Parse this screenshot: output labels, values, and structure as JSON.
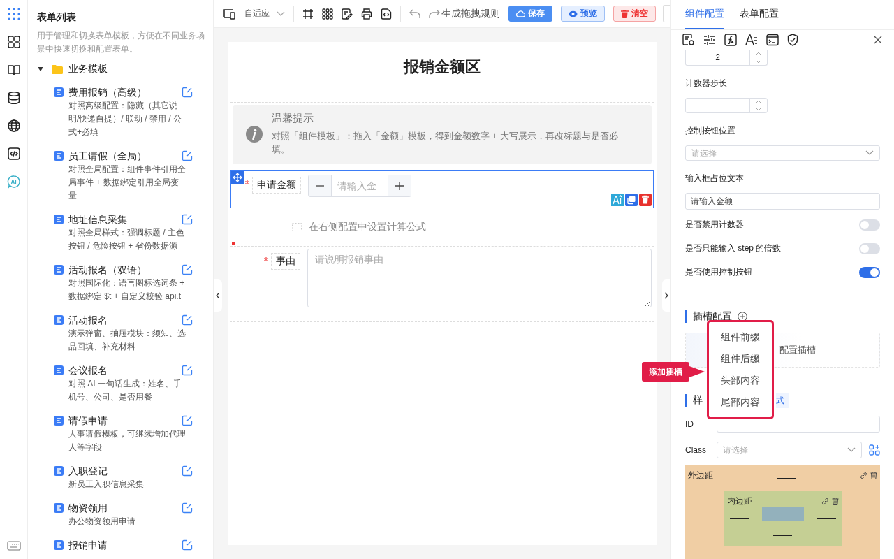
{
  "sidebar": {
    "title": "表单列表",
    "description": "用于管理和切换表单模板，方便在不同业务场景中快速切换和配置表单。",
    "folder": {
      "label": "业务模板",
      "expanded": true,
      "children": [
        {
          "title": "费用报销（高级）",
          "desc": "对照高级配置：隐藏（其它说明/快递自提）/ 联动 / 禁用 / 公式+必填"
        },
        {
          "title": "员工请假（全局）",
          "desc": "对照全局配置：组件事件引用全局事件 + 数据绑定引用全局变量"
        },
        {
          "title": "地址信息采集",
          "desc": "对照全局样式：强调标题 / 主色按钮 / 危险按钮 + 省份数据源"
        },
        {
          "title": "活动报名（双语）",
          "desc": "对照国际化：语言图标选词条 + 数据绑定 $t + 自定义校验 api.t"
        },
        {
          "title": "活动报名",
          "desc": "演示弹窗、抽屉模块：须知、选品回填、补充材料"
        },
        {
          "title": "会议报名",
          "desc": "对照 AI 一句话生成：姓名、手机号、公司、是否用餐"
        },
        {
          "title": "请假申请",
          "desc": "人事请假模板，可继续增加代理人等字段"
        },
        {
          "title": "入职登记",
          "desc": "新员工入职信息采集"
        },
        {
          "title": "物资领用",
          "desc": "办公物资领用申请"
        },
        {
          "title": "报销申请"
        }
      ]
    }
  },
  "toolbar": {
    "device": "自适应",
    "generate": "生成拖拽规则",
    "buttons": [
      {
        "label": "保存",
        "kind": "primary"
      },
      {
        "label": "预览",
        "kind": "info"
      },
      {
        "label": "清空",
        "kind": "danger"
      }
    ]
  },
  "canvas": {
    "heading": "报销金额区",
    "alert": {
      "title": "温馨提示",
      "text": "对照「组件模板」：拖入「金额」模板，得到金额数字 + 大写展示，再改标题与是否必填。"
    },
    "amount": {
      "label": "申请金额",
      "required": true,
      "placeholder": "请输入金",
      "selected": true
    },
    "formula_hint": "在右侧配置中设置计算公式",
    "reason": {
      "label": "事由",
      "required": true,
      "placeholder": "请说明报销事由"
    }
  },
  "panel": {
    "tabs": [
      {
        "label": "组件配置",
        "selected": true
      },
      {
        "label": "表单配置",
        "selected": false
      }
    ],
    "props": [
      {
        "kind": "number",
        "value": "2"
      },
      {
        "kind": "label",
        "text": "计数器步长"
      },
      {
        "kind": "number"
      },
      {
        "kind": "label",
        "text": "控制按钮位置"
      },
      {
        "kind": "select",
        "placeholder": "请选择"
      },
      {
        "kind": "label",
        "text": "输入框占位文本"
      },
      {
        "kind": "input",
        "value": "请输入金额"
      },
      {
        "kind": "switch",
        "text": "是否禁用计数器",
        "on": false
      },
      {
        "kind": "switch",
        "text": "是否只能输入 step 的倍数",
        "on": false
      },
      {
        "kind": "switch",
        "text": "是否使用控制按钮",
        "on": true
      }
    ],
    "slot_title": "插槽配置",
    "slot_hint": "配置插槽",
    "style_title": "样",
    "style_tag": "式",
    "id_label": "ID",
    "class_label": "Class",
    "class_placeholder": "请选择",
    "margin_label": "外边距",
    "padding_label": "内边距"
  },
  "popover": {
    "items": [
      "组件前缀",
      "组件后缀",
      "头部内容",
      "尾部内容"
    ]
  },
  "callout": "添加插槽"
}
